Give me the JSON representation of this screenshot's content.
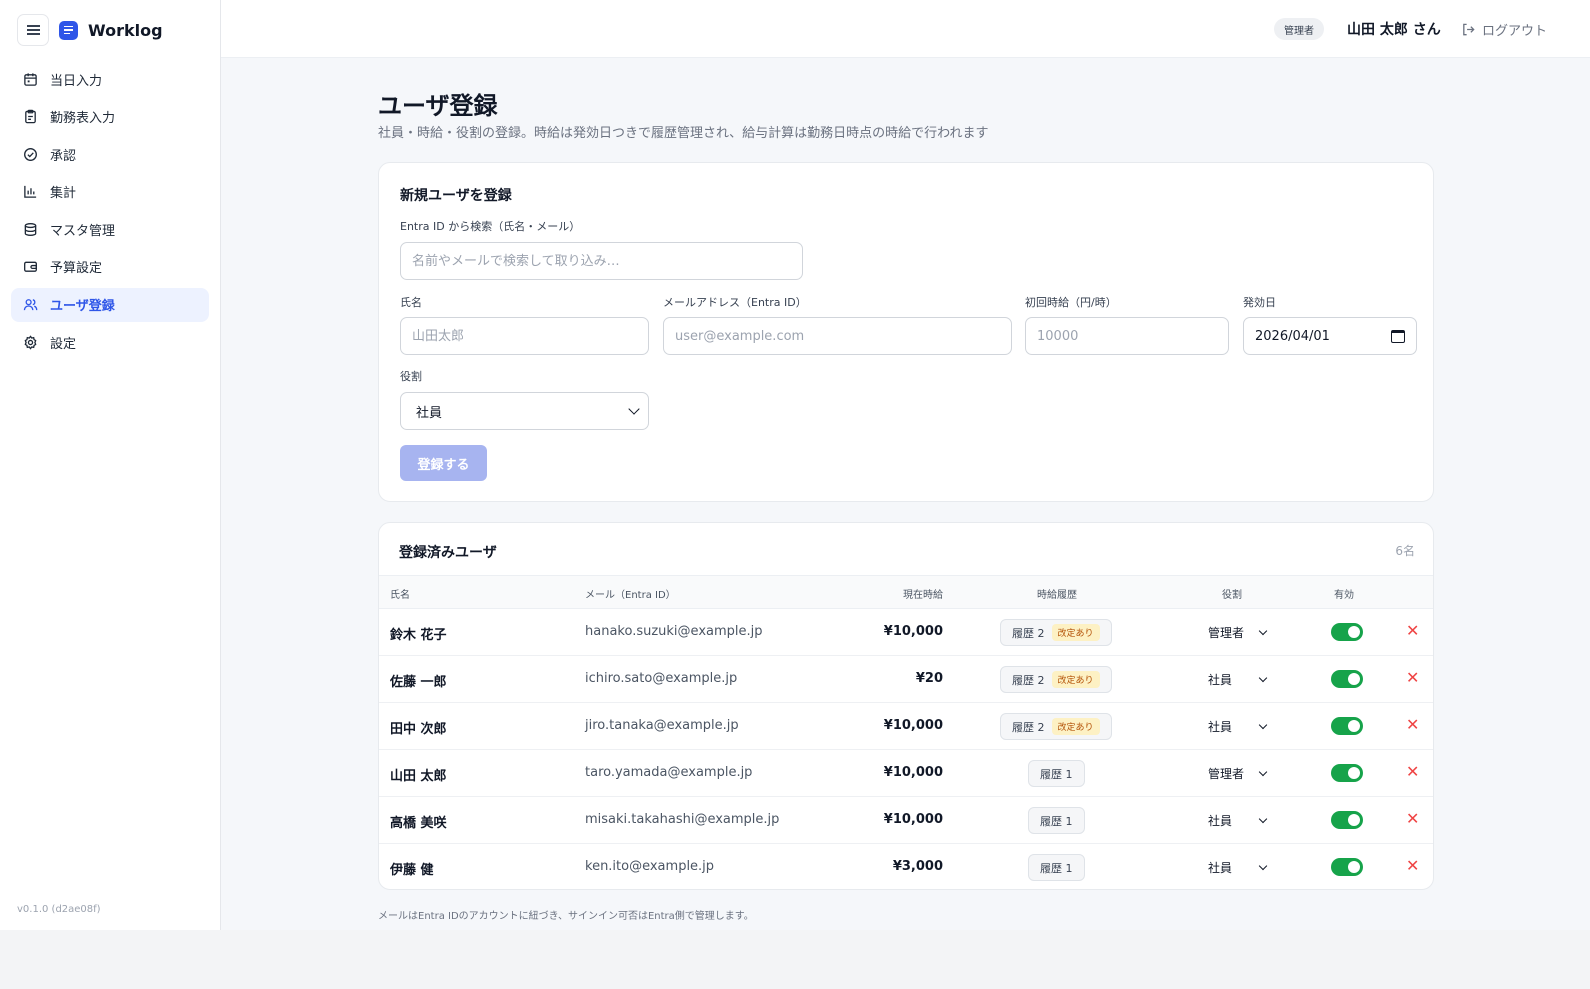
{
  "app": {
    "name": "Worklog",
    "version": "v0.1.0 (d2ae08f)"
  },
  "header": {
    "role_badge": "管理者",
    "user_name": "山田 太郎 さん",
    "logout_label": "ログアウト"
  },
  "sidebar": {
    "items": [
      {
        "label": "当日入力",
        "icon": "calendar-icon"
      },
      {
        "label": "勤務表入力",
        "icon": "clipboard-icon"
      },
      {
        "label": "承認",
        "icon": "check-circle-icon"
      },
      {
        "label": "集計",
        "icon": "bar-chart-icon"
      },
      {
        "label": "マスタ管理",
        "icon": "database-icon"
      },
      {
        "label": "予算設定",
        "icon": "wallet-icon"
      },
      {
        "label": "ユーザ登録",
        "icon": "users-icon",
        "active": true
      },
      {
        "label": "設定",
        "icon": "gear-icon"
      }
    ]
  },
  "page": {
    "title": "ユーザ登録",
    "subtitle": "社員・時給・役割の登録。時給は発効日つきで履歴管理され、給与計算は勤務日時点の時給で行われます"
  },
  "form": {
    "title": "新規ユーザを登録",
    "search": {
      "label": "Entra ID から検索（氏名・メール）",
      "placeholder": "名前やメールで検索して取り込み…"
    },
    "name": {
      "label": "氏名",
      "placeholder": "山田太郎"
    },
    "email": {
      "label": "メールアドレス（Entra ID）",
      "placeholder": "user@example.com"
    },
    "rate": {
      "label": "初回時給（円/時）",
      "placeholder": "10000"
    },
    "effective_date": {
      "label": "発効日",
      "value": "2026/04/01"
    },
    "role": {
      "label": "役割",
      "value": "社員"
    },
    "submit_label": "登録する"
  },
  "users_table": {
    "title": "登録済みユーザ",
    "count": "6名",
    "columns": [
      "氏名",
      "メール（Entra ID）",
      "現在時給",
      "時給履歴",
      "役割",
      "有効"
    ],
    "rows": [
      {
        "name": "鈴木 花子",
        "email": "hanako.suzuki@example.jp",
        "rate": "¥10,000",
        "history": "履歴 2",
        "revised": "改定あり",
        "role": "管理者",
        "active": true
      },
      {
        "name": "佐藤 一郎",
        "email": "ichiro.sato@example.jp",
        "rate": "¥20",
        "history": "履歴 2",
        "revised": "改定あり",
        "role": "社員",
        "active": true
      },
      {
        "name": "田中 次郎",
        "email": "jiro.tanaka@example.jp",
        "rate": "¥10,000",
        "history": "履歴 2",
        "revised": "改定あり",
        "role": "社員",
        "active": true
      },
      {
        "name": "山田 太郎",
        "email": "taro.yamada@example.jp",
        "rate": "¥10,000",
        "history": "履歴 1",
        "revised": "",
        "role": "管理者",
        "active": true
      },
      {
        "name": "高橋 美咲",
        "email": "misaki.takahashi@example.jp",
        "rate": "¥10,000",
        "history": "履歴 1",
        "revised": "",
        "role": "社員",
        "active": true
      },
      {
        "name": "伊藤 健",
        "email": "ken.ito@example.jp",
        "rate": "¥3,000",
        "history": "履歴 1",
        "revised": "",
        "role": "社員",
        "active": true
      }
    ]
  },
  "footnote": "メールはEntra IDのアカウントに紐づき、サインイン可否はEntra側で管理します。",
  "colors": {
    "accent": "#2f56e8",
    "toggle_on": "#16a34a",
    "delete": "#ef4444"
  }
}
